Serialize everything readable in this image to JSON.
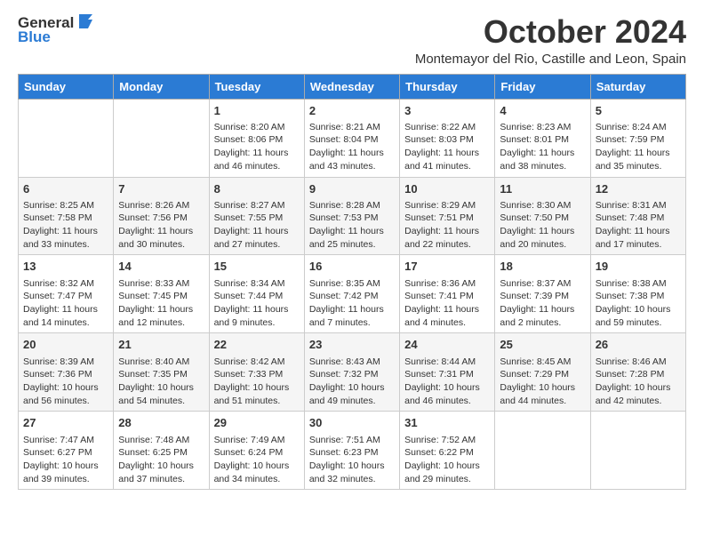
{
  "header": {
    "logo_general": "General",
    "logo_blue": "Blue",
    "month_year": "October 2024",
    "location": "Montemayor del Rio, Castille and Leon, Spain"
  },
  "weekdays": [
    "Sunday",
    "Monday",
    "Tuesday",
    "Wednesday",
    "Thursday",
    "Friday",
    "Saturday"
  ],
  "weeks": [
    [
      {
        "day": "",
        "sunrise": "",
        "sunset": "",
        "daylight": ""
      },
      {
        "day": "",
        "sunrise": "",
        "sunset": "",
        "daylight": ""
      },
      {
        "day": "1",
        "sunrise": "Sunrise: 8:20 AM",
        "sunset": "Sunset: 8:06 PM",
        "daylight": "Daylight: 11 hours and 46 minutes."
      },
      {
        "day": "2",
        "sunrise": "Sunrise: 8:21 AM",
        "sunset": "Sunset: 8:04 PM",
        "daylight": "Daylight: 11 hours and 43 minutes."
      },
      {
        "day": "3",
        "sunrise": "Sunrise: 8:22 AM",
        "sunset": "Sunset: 8:03 PM",
        "daylight": "Daylight: 11 hours and 41 minutes."
      },
      {
        "day": "4",
        "sunrise": "Sunrise: 8:23 AM",
        "sunset": "Sunset: 8:01 PM",
        "daylight": "Daylight: 11 hours and 38 minutes."
      },
      {
        "day": "5",
        "sunrise": "Sunrise: 8:24 AM",
        "sunset": "Sunset: 7:59 PM",
        "daylight": "Daylight: 11 hours and 35 minutes."
      }
    ],
    [
      {
        "day": "6",
        "sunrise": "Sunrise: 8:25 AM",
        "sunset": "Sunset: 7:58 PM",
        "daylight": "Daylight: 11 hours and 33 minutes."
      },
      {
        "day": "7",
        "sunrise": "Sunrise: 8:26 AM",
        "sunset": "Sunset: 7:56 PM",
        "daylight": "Daylight: 11 hours and 30 minutes."
      },
      {
        "day": "8",
        "sunrise": "Sunrise: 8:27 AM",
        "sunset": "Sunset: 7:55 PM",
        "daylight": "Daylight: 11 hours and 27 minutes."
      },
      {
        "day": "9",
        "sunrise": "Sunrise: 8:28 AM",
        "sunset": "Sunset: 7:53 PM",
        "daylight": "Daylight: 11 hours and 25 minutes."
      },
      {
        "day": "10",
        "sunrise": "Sunrise: 8:29 AM",
        "sunset": "Sunset: 7:51 PM",
        "daylight": "Daylight: 11 hours and 22 minutes."
      },
      {
        "day": "11",
        "sunrise": "Sunrise: 8:30 AM",
        "sunset": "Sunset: 7:50 PM",
        "daylight": "Daylight: 11 hours and 20 minutes."
      },
      {
        "day": "12",
        "sunrise": "Sunrise: 8:31 AM",
        "sunset": "Sunset: 7:48 PM",
        "daylight": "Daylight: 11 hours and 17 minutes."
      }
    ],
    [
      {
        "day": "13",
        "sunrise": "Sunrise: 8:32 AM",
        "sunset": "Sunset: 7:47 PM",
        "daylight": "Daylight: 11 hours and 14 minutes."
      },
      {
        "day": "14",
        "sunrise": "Sunrise: 8:33 AM",
        "sunset": "Sunset: 7:45 PM",
        "daylight": "Daylight: 11 hours and 12 minutes."
      },
      {
        "day": "15",
        "sunrise": "Sunrise: 8:34 AM",
        "sunset": "Sunset: 7:44 PM",
        "daylight": "Daylight: 11 hours and 9 minutes."
      },
      {
        "day": "16",
        "sunrise": "Sunrise: 8:35 AM",
        "sunset": "Sunset: 7:42 PM",
        "daylight": "Daylight: 11 hours and 7 minutes."
      },
      {
        "day": "17",
        "sunrise": "Sunrise: 8:36 AM",
        "sunset": "Sunset: 7:41 PM",
        "daylight": "Daylight: 11 hours and 4 minutes."
      },
      {
        "day": "18",
        "sunrise": "Sunrise: 8:37 AM",
        "sunset": "Sunset: 7:39 PM",
        "daylight": "Daylight: 11 hours and 2 minutes."
      },
      {
        "day": "19",
        "sunrise": "Sunrise: 8:38 AM",
        "sunset": "Sunset: 7:38 PM",
        "daylight": "Daylight: 10 hours and 59 minutes."
      }
    ],
    [
      {
        "day": "20",
        "sunrise": "Sunrise: 8:39 AM",
        "sunset": "Sunset: 7:36 PM",
        "daylight": "Daylight: 10 hours and 56 minutes."
      },
      {
        "day": "21",
        "sunrise": "Sunrise: 8:40 AM",
        "sunset": "Sunset: 7:35 PM",
        "daylight": "Daylight: 10 hours and 54 minutes."
      },
      {
        "day": "22",
        "sunrise": "Sunrise: 8:42 AM",
        "sunset": "Sunset: 7:33 PM",
        "daylight": "Daylight: 10 hours and 51 minutes."
      },
      {
        "day": "23",
        "sunrise": "Sunrise: 8:43 AM",
        "sunset": "Sunset: 7:32 PM",
        "daylight": "Daylight: 10 hours and 49 minutes."
      },
      {
        "day": "24",
        "sunrise": "Sunrise: 8:44 AM",
        "sunset": "Sunset: 7:31 PM",
        "daylight": "Daylight: 10 hours and 46 minutes."
      },
      {
        "day": "25",
        "sunrise": "Sunrise: 8:45 AM",
        "sunset": "Sunset: 7:29 PM",
        "daylight": "Daylight: 10 hours and 44 minutes."
      },
      {
        "day": "26",
        "sunrise": "Sunrise: 8:46 AM",
        "sunset": "Sunset: 7:28 PM",
        "daylight": "Daylight: 10 hours and 42 minutes."
      }
    ],
    [
      {
        "day": "27",
        "sunrise": "Sunrise: 7:47 AM",
        "sunset": "Sunset: 6:27 PM",
        "daylight": "Daylight: 10 hours and 39 minutes."
      },
      {
        "day": "28",
        "sunrise": "Sunrise: 7:48 AM",
        "sunset": "Sunset: 6:25 PM",
        "daylight": "Daylight: 10 hours and 37 minutes."
      },
      {
        "day": "29",
        "sunrise": "Sunrise: 7:49 AM",
        "sunset": "Sunset: 6:24 PM",
        "daylight": "Daylight: 10 hours and 34 minutes."
      },
      {
        "day": "30",
        "sunrise": "Sunrise: 7:51 AM",
        "sunset": "Sunset: 6:23 PM",
        "daylight": "Daylight: 10 hours and 32 minutes."
      },
      {
        "day": "31",
        "sunrise": "Sunrise: 7:52 AM",
        "sunset": "Sunset: 6:22 PM",
        "daylight": "Daylight: 10 hours and 29 minutes."
      },
      {
        "day": "",
        "sunrise": "",
        "sunset": "",
        "daylight": ""
      },
      {
        "day": "",
        "sunrise": "",
        "sunset": "",
        "daylight": ""
      }
    ]
  ]
}
